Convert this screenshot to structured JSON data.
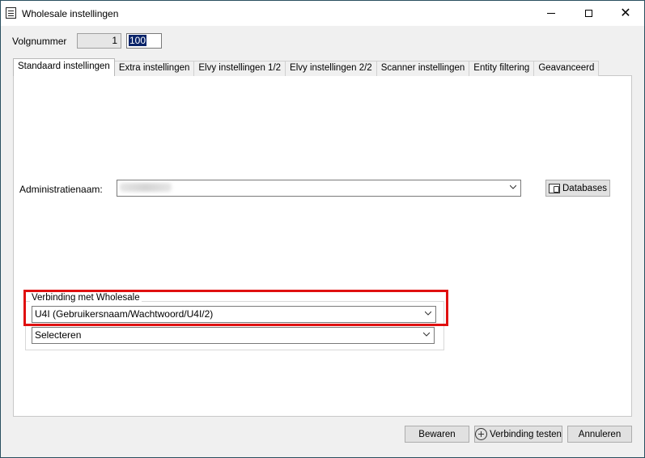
{
  "window": {
    "title": "Wholesale instellingen",
    "minimize_icon": "minimize-icon",
    "maximize_icon": "maximize-icon",
    "close_icon": "close-icon",
    "close_glyph": "✕"
  },
  "header": {
    "volgnummer_label": "Volgnummer",
    "volgnummer_value": "1",
    "volgnummer_input": "100"
  },
  "tabs": [
    {
      "label": "Standaard instellingen",
      "active": true
    },
    {
      "label": "Extra instellingen",
      "active": false
    },
    {
      "label": "Elvy instellingen 1/2",
      "active": false
    },
    {
      "label": "Elvy instellingen 2/2",
      "active": false
    },
    {
      "label": "Scanner instellingen",
      "active": false
    },
    {
      "label": "Entity filtering",
      "active": false
    },
    {
      "label": "Geavanceerd",
      "active": false
    }
  ],
  "standaard": {
    "admin_label": "Administratienaam:",
    "admin_value_redacted": true,
    "databases_button": "Databases",
    "group_title": "Verbinding met Wholesale",
    "connection_value": "U4I (Gebruikersnaam/Wachtwoord/U4I/2)",
    "select_value": "Selecteren"
  },
  "footer": {
    "save": "Bewaren",
    "test_connection": "Verbinding testen",
    "cancel": "Annuleren"
  },
  "colors": {
    "highlight": "#e01010",
    "selection": "#0a246a"
  }
}
